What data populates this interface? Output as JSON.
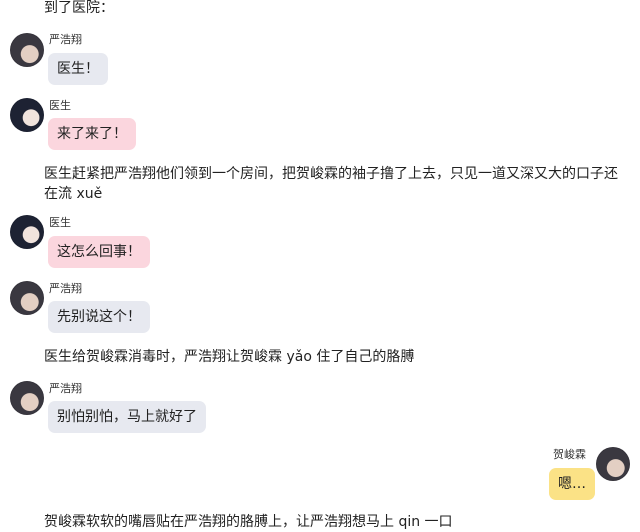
{
  "narration": {
    "n0": "到了医院：",
    "n1": "医生赶紧把严浩翔他们领到一个房间，把贺峻霖的袖子撸了上去，只见一道又深又大的口子还在流 xuě",
    "n2": "医生给贺峻霖消毒时，严浩翔让贺峻霖 yǎo 住了自己的胳膊",
    "n3": "贺峻霖软软的嘴唇贴在严浩翔的胳膊上，让严浩翔想马上 qin 一口"
  },
  "messages": [
    {
      "speaker": "严浩翔",
      "text": "医生！",
      "color": "#e7e9f0",
      "side": "left"
    },
    {
      "speaker": "医生",
      "text": "来了来了！",
      "color": "#fbd6de",
      "side": "left"
    },
    {
      "speaker": "医生",
      "text": "这怎么回事！",
      "color": "#fbd6de",
      "side": "left"
    },
    {
      "speaker": "严浩翔",
      "text": "先别说这个！",
      "color": "#e7e9f0",
      "side": "left"
    },
    {
      "speaker": "严浩翔",
      "text": "别怕别怕，马上就好了",
      "color": "#e7e9f0",
      "side": "left"
    },
    {
      "speaker": "贺峻霖",
      "text": "嗯…",
      "color": "#fbe286",
      "side": "right"
    }
  ]
}
